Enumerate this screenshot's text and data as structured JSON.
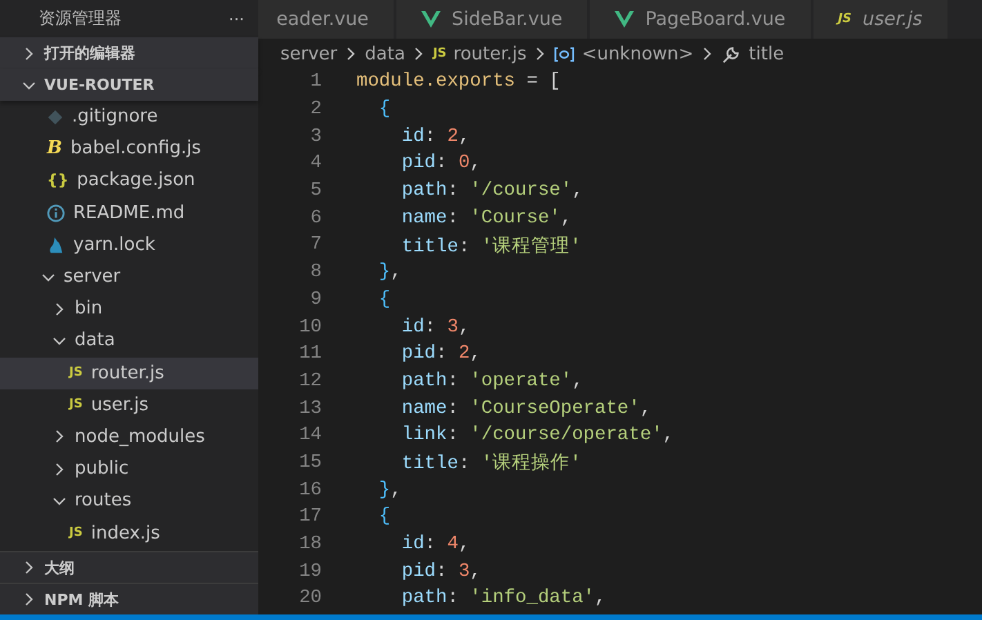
{
  "sidebar": {
    "title": "资源管理器",
    "more": "···",
    "sections": [
      {
        "label": "打开的编辑器",
        "expanded": false
      },
      {
        "label": "VUE-ROUTER",
        "expanded": true
      }
    ],
    "tree": [
      {
        "name": ".gitignore",
        "kind": "git"
      },
      {
        "name": "babel.config.js",
        "kind": "babel",
        "badge": "B"
      },
      {
        "name": "package.json",
        "kind": "json",
        "badge": "{}"
      },
      {
        "name": "README.md",
        "kind": "info"
      },
      {
        "name": "yarn.lock",
        "kind": "yarn"
      },
      {
        "name": "server",
        "kind": "folder",
        "expanded": true,
        "selected": false,
        "children": [
          {
            "name": "bin",
            "kind": "folder",
            "expanded": false,
            "selected": false
          },
          {
            "name": "data",
            "kind": "folder",
            "expanded": true,
            "selected": false,
            "children": [
              {
                "name": "router.js",
                "kind": "js",
                "badge": "JS",
                "selected": true
              },
              {
                "name": "user.js",
                "kind": "js",
                "badge": "JS",
                "selected": false
              }
            ]
          },
          {
            "name": "node_modules",
            "kind": "folder",
            "expanded": false,
            "selected": false
          },
          {
            "name": "public",
            "kind": "folder",
            "expanded": false,
            "selected": false
          },
          {
            "name": "routes",
            "kind": "folder",
            "expanded": true,
            "selected": false,
            "children": [
              {
                "name": "index.js",
                "kind": "js",
                "badge": "JS",
                "selected": false
              }
            ]
          }
        ]
      }
    ],
    "panels": [
      {
        "label": "大纲",
        "expanded": false
      },
      {
        "label": "NPM 脚本",
        "expanded": false
      }
    ]
  },
  "tabs": [
    {
      "label": "eader.vue",
      "kind": "plain",
      "italic": false,
      "selected": false
    },
    {
      "label": "SideBar.vue",
      "kind": "vue",
      "italic": false,
      "selected": false
    },
    {
      "label": "PageBoard.vue",
      "kind": "vue",
      "italic": false,
      "selected": false
    },
    {
      "label": "user.js",
      "kind": "js",
      "badge": "JS",
      "italic": true,
      "selected": false
    }
  ],
  "breadcrumb": [
    {
      "text": "server",
      "kind": "plain"
    },
    {
      "text": "data",
      "kind": "plain"
    },
    {
      "text": "router.js",
      "kind": "js",
      "badge": "JS"
    },
    {
      "text": "<unknown>",
      "kind": "symbol"
    },
    {
      "text": "title",
      "kind": "wrench"
    }
  ],
  "code": [
    {
      "number": "1",
      "tokens": [
        {
          "kind": "var",
          "text": "module.exports"
        },
        {
          "kind": "punct",
          "text": " = ["
        }
      ]
    },
    {
      "number": "2",
      "tokens": [
        {
          "kind": "brace",
          "text": "  {"
        }
      ]
    },
    {
      "number": "3",
      "tokens": [
        {
          "kind": "key",
          "text": "    id"
        },
        {
          "kind": "punct",
          "text": ": "
        },
        {
          "kind": "num",
          "text": "2"
        },
        {
          "kind": "punct",
          "text": ","
        }
      ]
    },
    {
      "number": "4",
      "tokens": [
        {
          "kind": "key",
          "text": "    pid"
        },
        {
          "kind": "punct",
          "text": ": "
        },
        {
          "kind": "num",
          "text": "0"
        },
        {
          "kind": "punct",
          "text": ","
        }
      ]
    },
    {
      "number": "5",
      "tokens": [
        {
          "kind": "key",
          "text": "    path"
        },
        {
          "kind": "punct",
          "text": ": "
        },
        {
          "kind": "str",
          "text": "'/course'"
        },
        {
          "kind": "punct",
          "text": ","
        }
      ]
    },
    {
      "number": "6",
      "tokens": [
        {
          "kind": "key",
          "text": "    name"
        },
        {
          "kind": "punct",
          "text": ": "
        },
        {
          "kind": "str",
          "text": "'Course'"
        },
        {
          "kind": "punct",
          "text": ","
        }
      ]
    },
    {
      "number": "7",
      "tokens": [
        {
          "kind": "key",
          "text": "    title"
        },
        {
          "kind": "punct",
          "text": ": "
        },
        {
          "kind": "str",
          "text": "'课程管理'"
        }
      ]
    },
    {
      "number": "8",
      "tokens": [
        {
          "kind": "brace",
          "text": "  }"
        },
        {
          "kind": "punct",
          "text": ","
        }
      ]
    },
    {
      "number": "9",
      "tokens": [
        {
          "kind": "brace",
          "text": "  {"
        }
      ]
    },
    {
      "number": "10",
      "tokens": [
        {
          "kind": "key",
          "text": "    id"
        },
        {
          "kind": "punct",
          "text": ": "
        },
        {
          "kind": "num",
          "text": "3"
        },
        {
          "kind": "punct",
          "text": ","
        }
      ]
    },
    {
      "number": "11",
      "tokens": [
        {
          "kind": "key",
          "text": "    pid"
        },
        {
          "kind": "punct",
          "text": ": "
        },
        {
          "kind": "num",
          "text": "2"
        },
        {
          "kind": "punct",
          "text": ","
        }
      ]
    },
    {
      "number": "12",
      "tokens": [
        {
          "kind": "key",
          "text": "    path"
        },
        {
          "kind": "punct",
          "text": ": "
        },
        {
          "kind": "str",
          "text": "'operate'"
        },
        {
          "kind": "punct",
          "text": ","
        }
      ]
    },
    {
      "number": "13",
      "tokens": [
        {
          "kind": "key",
          "text": "    name"
        },
        {
          "kind": "punct",
          "text": ": "
        },
        {
          "kind": "str",
          "text": "'CourseOperate'"
        },
        {
          "kind": "punct",
          "text": ","
        }
      ]
    },
    {
      "number": "14",
      "tokens": [
        {
          "kind": "key",
          "text": "    link"
        },
        {
          "kind": "punct",
          "text": ": "
        },
        {
          "kind": "str",
          "text": "'/course/operate'"
        },
        {
          "kind": "punct",
          "text": ","
        }
      ]
    },
    {
      "number": "15",
      "tokens": [
        {
          "kind": "key",
          "text": "    title"
        },
        {
          "kind": "punct",
          "text": ": "
        },
        {
          "kind": "str",
          "text": "'课程操作'"
        }
      ]
    },
    {
      "number": "16",
      "tokens": [
        {
          "kind": "brace",
          "text": "  }"
        },
        {
          "kind": "punct",
          "text": ","
        }
      ]
    },
    {
      "number": "17",
      "tokens": [
        {
          "kind": "brace",
          "text": "  {"
        }
      ]
    },
    {
      "number": "18",
      "tokens": [
        {
          "kind": "key",
          "text": "    id"
        },
        {
          "kind": "punct",
          "text": ": "
        },
        {
          "kind": "num",
          "text": "4"
        },
        {
          "kind": "punct",
          "text": ","
        }
      ]
    },
    {
      "number": "19",
      "tokens": [
        {
          "kind": "key",
          "text": "    pid"
        },
        {
          "kind": "punct",
          "text": ": "
        },
        {
          "kind": "num",
          "text": "3"
        },
        {
          "kind": "punct",
          "text": ","
        }
      ]
    },
    {
      "number": "20",
      "tokens": [
        {
          "kind": "key",
          "text": "    path"
        },
        {
          "kind": "punct",
          "text": ": "
        },
        {
          "kind": "str",
          "text": "'info_data'"
        },
        {
          "kind": "punct",
          "text": ","
        }
      ]
    }
  ]
}
